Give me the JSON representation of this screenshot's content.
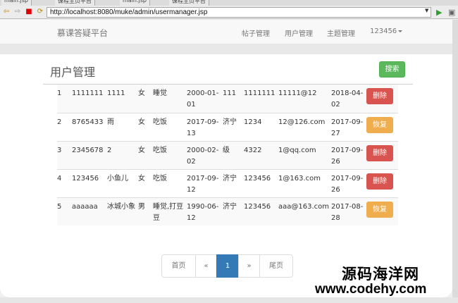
{
  "browser": {
    "tabs": [
      "main.jsp",
      "课程主页平台",
      "main.jsp",
      "课程主页平台"
    ],
    "url": "http://localhost:8080/muke/admin/usermanager.jsp"
  },
  "navbar": {
    "brand": "慕课答疑平台",
    "links": [
      "帖子管理",
      "用户管理",
      "主题管理"
    ],
    "user": "123456"
  },
  "page": {
    "title": "用户管理",
    "search_label": "搜索"
  },
  "users": [
    {
      "no": "1",
      "account": "1111111",
      "name": "1111",
      "gender": "女",
      "hobby": "睡觉",
      "birth": "2000-01-01",
      "place": "111",
      "phone": "1111111",
      "email": "11111@12",
      "date": "2018-04-02",
      "action": "删除",
      "action_type": "danger"
    },
    {
      "no": "2",
      "account": "8765433",
      "name": "雨",
      "gender": "女",
      "hobby": "吃饭",
      "birth": "2017-09-13",
      "place": "济宁",
      "phone": "1234",
      "email": "12@126.com",
      "date": "2017-09-27",
      "action": "恢复",
      "action_type": "warning"
    },
    {
      "no": "3",
      "account": "2345678",
      "name": "2",
      "gender": "女",
      "hobby": "吃饭",
      "birth": "2000-02-02",
      "place": "级",
      "phone": "4322",
      "email": "1@qq.com",
      "date": "2017-09-26",
      "action": "删除",
      "action_type": "danger"
    },
    {
      "no": "4",
      "account": "123456",
      "name": "小鱼儿",
      "gender": "女",
      "hobby": "吃饭",
      "birth": "2017-09-12",
      "place": "济宁",
      "phone": "123456",
      "email": "1@163.com",
      "date": "2017-09-26",
      "action": "删除",
      "action_type": "danger"
    },
    {
      "no": "5",
      "account": "aaaaaa",
      "name": "冰城小象",
      "gender": "男",
      "hobby": "睡觉,打豆豆",
      "birth": "1990-06-12",
      "place": "济宁",
      "phone": "123456",
      "email": "aaa@163.com",
      "date": "2017-08-28",
      "action": "恢复",
      "action_type": "warning"
    }
  ],
  "pagination": {
    "first": "首页",
    "prev": "«",
    "current": "1",
    "next": "»",
    "last": "尾页"
  },
  "watermark": {
    "cn": "源码海洋网",
    "en": "www.codehy.com"
  },
  "colors": {
    "primary": "#337ab7",
    "success": "#5cb85c",
    "danger": "#d9534f",
    "warning": "#f0ad4e"
  }
}
